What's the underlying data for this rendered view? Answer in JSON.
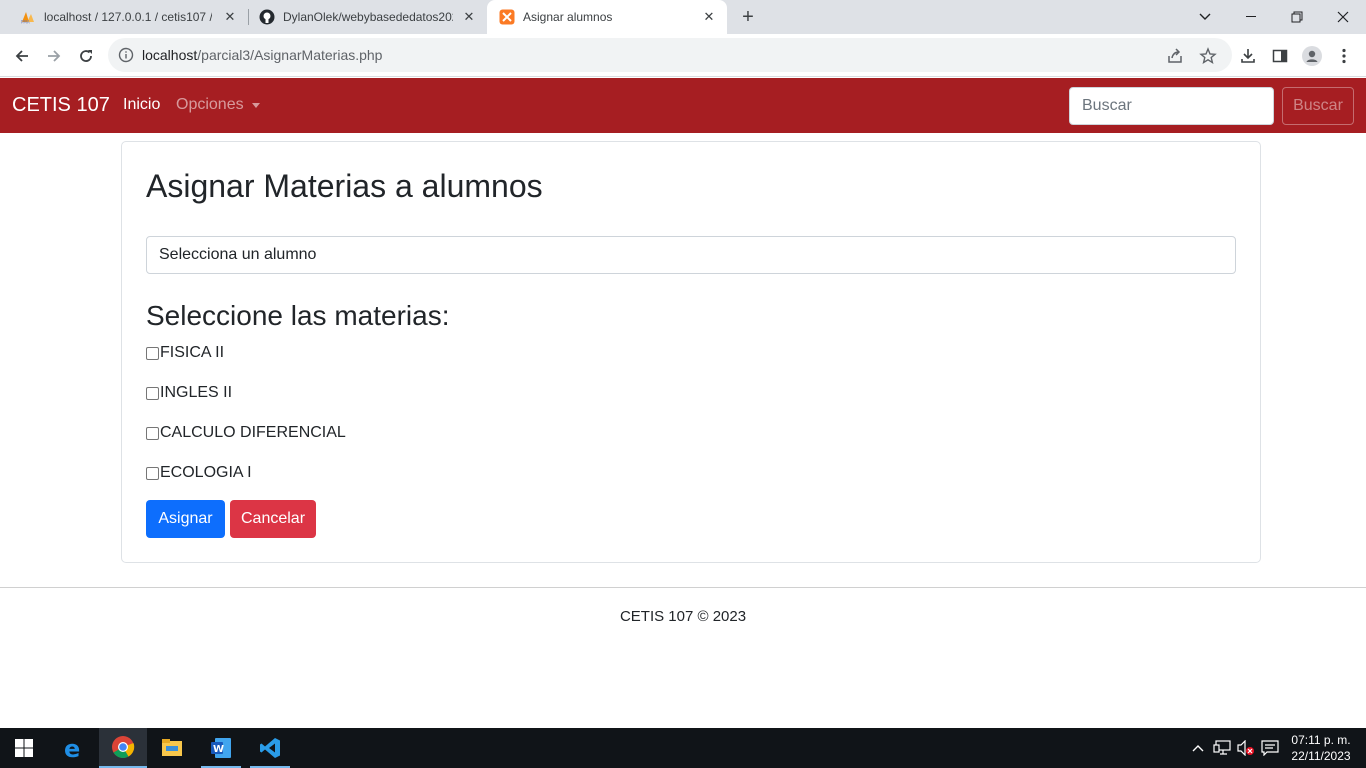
{
  "browser": {
    "tabs": [
      {
        "title": "localhost / 127.0.0.1 / cetis107 /",
        "favicon": "phpmyadmin-icon"
      },
      {
        "title": "DylanOlek/webybasededatos202",
        "favicon": "github-icon"
      },
      {
        "title": "Asignar alumnos",
        "favicon": "xampp-icon",
        "active": true
      }
    ],
    "url_host": "localhost",
    "url_path": "/parcial3/AsignarMaterias.php"
  },
  "navbar": {
    "brand": "CETIS 107",
    "inicio": "Inicio",
    "opciones": "Opciones",
    "search_placeholder": "Buscar",
    "search_button": "Buscar",
    "color": "#a61e22"
  },
  "card": {
    "title": "Asignar Materias a alumnos",
    "select_value": "Selecciona un alumno",
    "subtitle": "Seleccione las materias:",
    "materias": [
      "FISICA II",
      "INGLES II",
      "CALCULO DIFERENCIAL",
      "ECOLOGIA I"
    ],
    "assign_button": "Asignar",
    "cancel_button": "Cancelar"
  },
  "footer": {
    "text": "CETIS 107 © 2023"
  },
  "taskbar": {
    "time": "07:11 p. m.",
    "date": "22/11/2023"
  }
}
